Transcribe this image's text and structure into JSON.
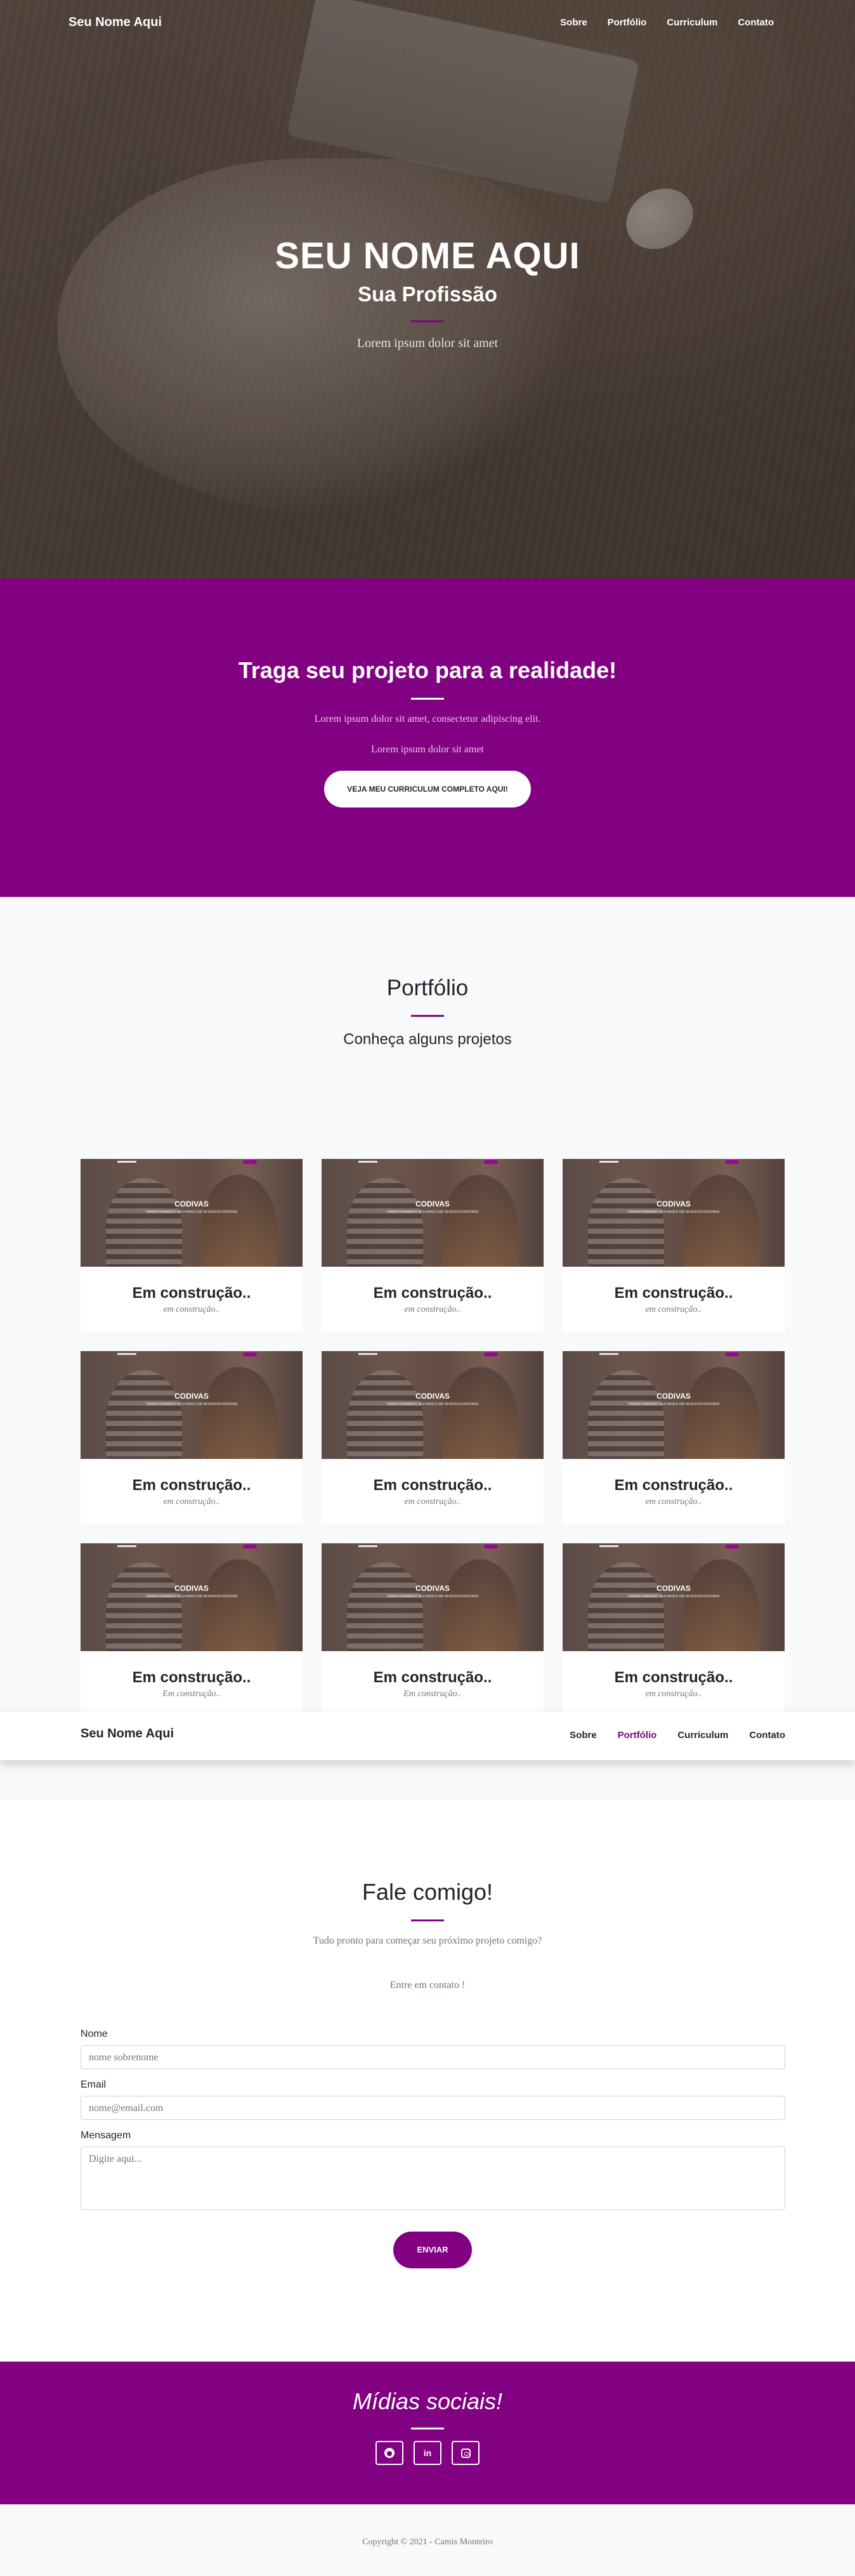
{
  "nav": {
    "brand": "Seu Nome Aqui",
    "items": [
      "Sobre",
      "Portfólio",
      "Curriculum",
      "Contato"
    ],
    "active_sticky": "Portfólio"
  },
  "hero": {
    "title": "SEU NOME AQUI",
    "subtitle": "Sua Profissão",
    "text": "Lorem ipsum dolor sit amet"
  },
  "cta": {
    "title": "Traga seu projeto para a realidade!",
    "line1": "Lorem ipsum dolor sit amet, consectetur adipiscing elit.",
    "line2": "Lorem ipsum dolor sit amet",
    "button": "VEJA MEU CURRICULUM COMPLETO AQUI!"
  },
  "portfolio": {
    "title": "Portfólio",
    "subtitle": "Conheça alguns projetos",
    "cards": [
      {
        "title": "Em construção..",
        "subtitle": "em construção..",
        "thumb_title": "CODIVAS",
        "thumb_sub": "TRANSFORMANDO MULHERES EM DESENVOLVEDORAS"
      },
      {
        "title": "Em construção..",
        "subtitle": "em construção..",
        "thumb_title": "CODIVAS",
        "thumb_sub": "TRANSFORMANDO MULHERES EM DESENVOLVEDORAS"
      },
      {
        "title": "Em construção..",
        "subtitle": "em construção..",
        "thumb_title": "CODIVAS",
        "thumb_sub": "TRANSFORMANDO MULHERES EM DESENVOLVEDORAS"
      },
      {
        "title": "Em construção..",
        "subtitle": "em construção..",
        "thumb_title": "CODIVAS",
        "thumb_sub": "TRANSFORMANDO MULHERES EM DESENVOLVEDORAS"
      },
      {
        "title": "Em construção..",
        "subtitle": "em construção..",
        "thumb_title": "CODIVAS",
        "thumb_sub": "TRANSFORMANDO MULHERES EM DESENVOLVEDORAS"
      },
      {
        "title": "Em construção..",
        "subtitle": "em construção..",
        "thumb_title": "CODIVAS",
        "thumb_sub": "TRANSFORMANDO MULHERES EM DESENVOLVEDORAS"
      },
      {
        "title": "Em construção..",
        "subtitle": "Em construção..",
        "thumb_title": "CODIVAS",
        "thumb_sub": "TRANSFORMANDO MULHERES EM DESENVOLVEDORAS"
      },
      {
        "title": "Em construção..",
        "subtitle": "Em construção..",
        "thumb_title": "CODIVAS",
        "thumb_sub": "TRANSFORMANDO MULHERES EM DESENVOLVEDORAS"
      },
      {
        "title": "Em construção..",
        "subtitle": "em construção..",
        "thumb_title": "CODIVAS",
        "thumb_sub": "TRANSFORMANDO MULHERES EM DESENVOLVEDORAS"
      }
    ]
  },
  "contact": {
    "title": "Fale comigo!",
    "lead": "Tudo pronto para começar seu próximo projeto comigo?",
    "lead2": "Entre em contato !",
    "name_label": "Nome",
    "name_placeholder": "nome sobrenome",
    "email_label": "Email",
    "email_placeholder": "nome@email.com",
    "message_label": "Mensagem",
    "message_placeholder": "Digite aqui...",
    "send": "ENVIAR"
  },
  "social": {
    "title": "Mídias sociais!",
    "icons": [
      "github-icon",
      "linkedin-icon",
      "instagram-icon"
    ],
    "linkedin_text": "in"
  },
  "footer": {
    "copyright": "Copyright © 2021 - Camis Monteiro"
  },
  "colors": {
    "accent": "#820082",
    "hero_overlay": "#4a3f37",
    "light_bg": "#f8f9fa"
  }
}
